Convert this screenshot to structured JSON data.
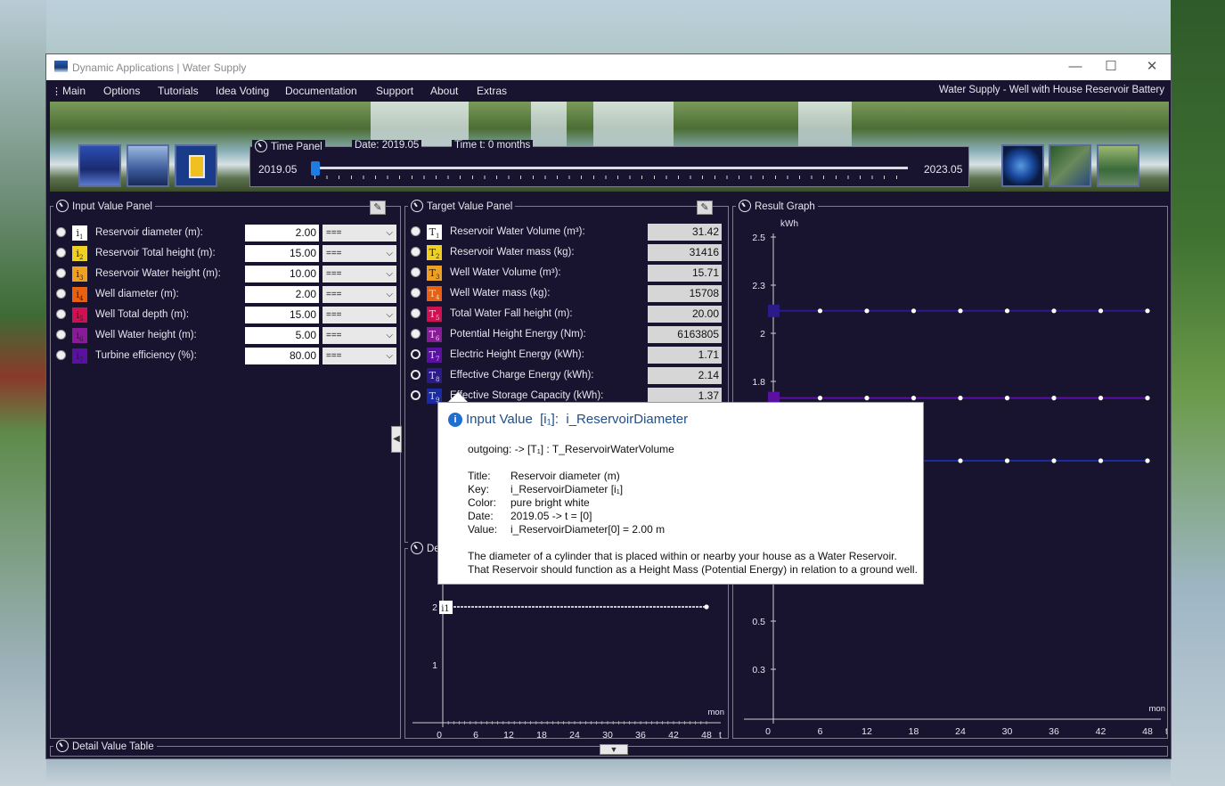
{
  "window": {
    "title": "Dynamic Applications | Water Supply",
    "buttons": {
      "minimize": "—",
      "maximize": "☐",
      "close": "✕"
    }
  },
  "menu": {
    "items": [
      "Main",
      "Options",
      "Tutorials",
      "Idea Voting",
      "Documentation",
      "Support",
      "About",
      "Extras"
    ],
    "right_title": "Water Supply - Well with House Reservoir Battery"
  },
  "time_panel": {
    "title": "Time Panel",
    "date_label": "Date:",
    "date_value": "2019.05",
    "time_label": "Time t:",
    "time_value": "0",
    "time_unit": "months",
    "start": "2019.05",
    "end": "2023.05",
    "slider_position": 0
  },
  "input_panel": {
    "title": "Input Value Panel",
    "rows": [
      {
        "key": "i",
        "sub": "1",
        "color": "#ffffff",
        "label": "Reservoir diameter (m):",
        "value": "2.00",
        "op": "==="
      },
      {
        "key": "i",
        "sub": "2",
        "color": "#f0d020",
        "label": "Reservoir Total height (m):",
        "value": "15.00",
        "op": "==="
      },
      {
        "key": "i",
        "sub": "3",
        "color": "#f0a020",
        "label": "Reservoir Water height (m):",
        "value": "10.00",
        "op": "==="
      },
      {
        "key": "i",
        "sub": "4",
        "color": "#e86010",
        "label": "Well diameter (m):",
        "value": "2.00",
        "op": "==="
      },
      {
        "key": "i",
        "sub": "5",
        "color": "#d01050",
        "label": "Well Total depth (m):",
        "value": "15.00",
        "op": "==="
      },
      {
        "key": "i",
        "sub": "6",
        "color": "#8a1a9a",
        "label": "Well Water height (m):",
        "value": "5.00",
        "op": "==="
      },
      {
        "key": "i",
        "sub": "7",
        "color": "#5a10a0",
        "label": "Turbine efficiency (%):",
        "value": "80.00",
        "op": "==="
      }
    ]
  },
  "target_panel": {
    "title": "Target Value Panel",
    "rows": [
      {
        "key": "T",
        "sub": "1",
        "color": "#ffffff",
        "label": "Reservoir Water Volume (m³):",
        "value": "31.42",
        "selected": false
      },
      {
        "key": "T",
        "sub": "2",
        "color": "#f0d020",
        "label": "Reservoir Water mass (kg):",
        "value": "31416",
        "selected": false
      },
      {
        "key": "T",
        "sub": "3",
        "color": "#f0a020",
        "label": "Well Water Volume (m³):",
        "value": "15.71",
        "selected": false
      },
      {
        "key": "T",
        "sub": "4",
        "color": "#e86010",
        "label": "Well Water mass (kg):",
        "value": "15708",
        "selected": false
      },
      {
        "key": "T",
        "sub": "5",
        "color": "#d01050",
        "label": "Total Water Fall height (m):",
        "value": "20.00",
        "selected": false
      },
      {
        "key": "T",
        "sub": "6",
        "color": "#8a1a9a",
        "label": "Potential Height Energy (Nm):",
        "value": "6163805",
        "selected": false
      },
      {
        "key": "T",
        "sub": "7",
        "color": "#5a10a0",
        "label": "Electric Height Energy (kWh):",
        "value": "1.71",
        "selected": true
      },
      {
        "key": "T",
        "sub": "8",
        "color": "#2a1a8a",
        "label": "Effective Charge Energy (kWh):",
        "value": "2.14",
        "selected": true
      },
      {
        "key": "T",
        "sub": "9",
        "color": "#1a2aa0",
        "label": "Effective Storage Capacity (kWh):",
        "value": "1.37",
        "selected": true
      }
    ]
  },
  "result_graph": {
    "title": "Result Graph",
    "unit": "kWh",
    "x_unit_top": "mon",
    "x_unit": "t"
  },
  "detail_graph": {
    "title": "Det",
    "x_unit_top": "mon",
    "x_unit": "t"
  },
  "detail_table": {
    "title": "Detail Value Table"
  },
  "tooltip": {
    "heading_prefix": "Input Value",
    "heading_key": "[i₁]:",
    "heading_name": "i_ReservoirDiameter",
    "outgoing": "outgoing:  ->  [T₁] :  T_ReservoirWaterVolume",
    "title_key": "Title:",
    "title_val": "Reservoir diameter (m)",
    "key_key": "Key:",
    "key_val": "i_ReservoirDiameter  [i₁]",
    "color_key": "Color:",
    "color_val": "pure bright white",
    "date_key": "Date:",
    "date_val": "2019.05  ->  t = [0]",
    "value_key": "Value:",
    "value_val": "i_ReservoirDiameter[0] = 2.00 m",
    "desc1": "The diameter of a cylinder that is placed within or nearby your house as a Water Reservoir.",
    "desc2": "That Reservoir should function as a Height Mass (Potential Energy) in relation to a ground well."
  },
  "chart_data": [
    {
      "type": "line",
      "title": "Result Graph",
      "ylabel": "kWh",
      "xlabel": "t",
      "x_ticks": [
        0,
        6,
        12,
        18,
        24,
        30,
        36,
        42,
        48
      ],
      "y_ticks_visible": [
        2.5,
        2.3,
        2,
        1.8,
        0.5,
        0.3
      ],
      "x": [
        0,
        6,
        12,
        18,
        24,
        30,
        36,
        42,
        48
      ],
      "series": [
        {
          "name": "T8",
          "color": "#2a1a8a",
          "values": [
            2.14,
            2.14,
            2.14,
            2.14,
            2.14,
            2.14,
            2.14,
            2.14,
            2.14
          ]
        },
        {
          "name": "T7",
          "color": "#5a10a0",
          "values": [
            1.71,
            1.71,
            1.71,
            1.71,
            1.71,
            1.71,
            1.71,
            1.71,
            1.71
          ]
        },
        {
          "name": "T9",
          "color": "#1a2aa0",
          "values": [
            1.37,
            1.37,
            1.37,
            1.37,
            1.37,
            1.37,
            1.37,
            1.37,
            1.37
          ]
        }
      ]
    },
    {
      "type": "line",
      "title": "Det",
      "xlabel": "t",
      "x_ticks": [
        0,
        6,
        12,
        18,
        24,
        30,
        36,
        42,
        48
      ],
      "y_ticks_visible": [
        2,
        1
      ],
      "x": [
        0,
        48
      ],
      "series": [
        {
          "name": "i1",
          "color": "#ffffff",
          "values": [
            2.0,
            2.0
          ]
        }
      ]
    }
  ]
}
